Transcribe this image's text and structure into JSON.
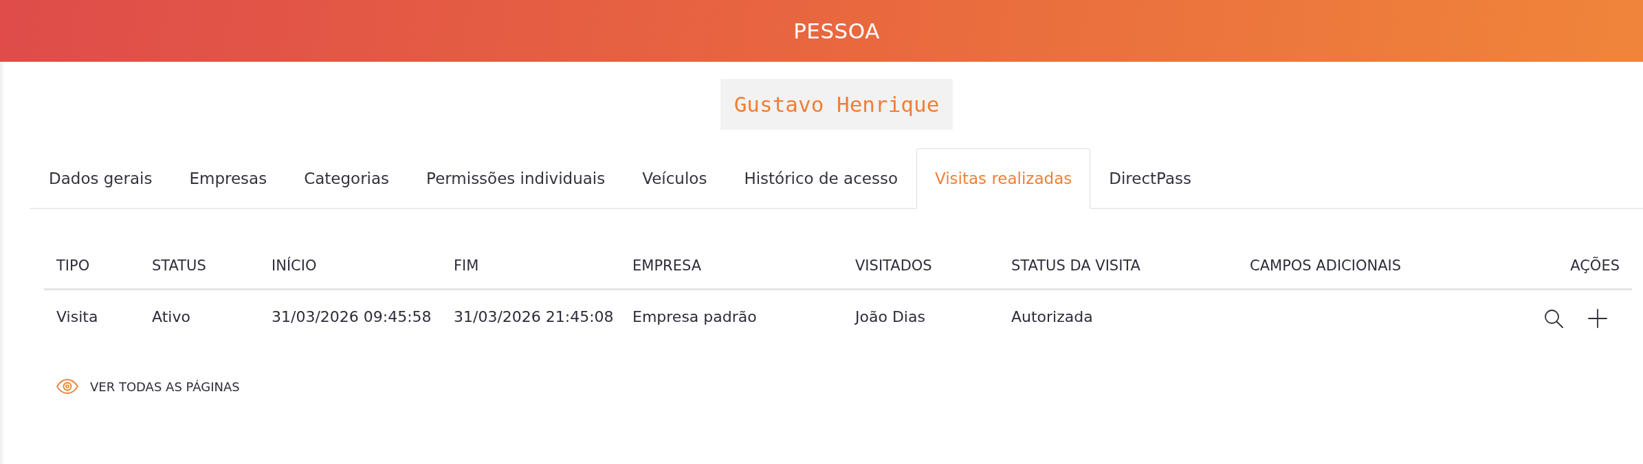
{
  "header": {
    "title": "PESSOA"
  },
  "person": {
    "name": "Gustavo Henrique"
  },
  "tabs": [
    {
      "label": "Dados gerais",
      "selected": false
    },
    {
      "label": "Empresas",
      "selected": false
    },
    {
      "label": "Categorias",
      "selected": false
    },
    {
      "label": "Permissões individuais",
      "selected": false
    },
    {
      "label": "Veículos",
      "selected": false
    },
    {
      "label": "Histórico de acesso",
      "selected": false
    },
    {
      "label": "Visitas realizadas",
      "selected": true
    },
    {
      "label": "DirectPass",
      "selected": false
    }
  ],
  "table": {
    "columns": [
      "TIPO",
      "STATUS",
      "INÍCIO",
      "FIM",
      "EMPRESA",
      "VISITADOS",
      "STATUS DA VISITA",
      "CAMPOS ADICIONAIS",
      "AÇÕES"
    ],
    "rows": [
      {
        "cells": [
          "Visita",
          "Ativo",
          "31/03/2026 09:45:58",
          "31/03/2026 21:45:08",
          "Empresa padrão",
          "João Dias",
          "Autorizada",
          null
        ],
        "actions": [
          {
            "kind": "search"
          },
          {
            "kind": "add"
          }
        ]
      }
    ]
  },
  "footer_link": {
    "label": "VER TODAS AS PÁGINAS"
  }
}
